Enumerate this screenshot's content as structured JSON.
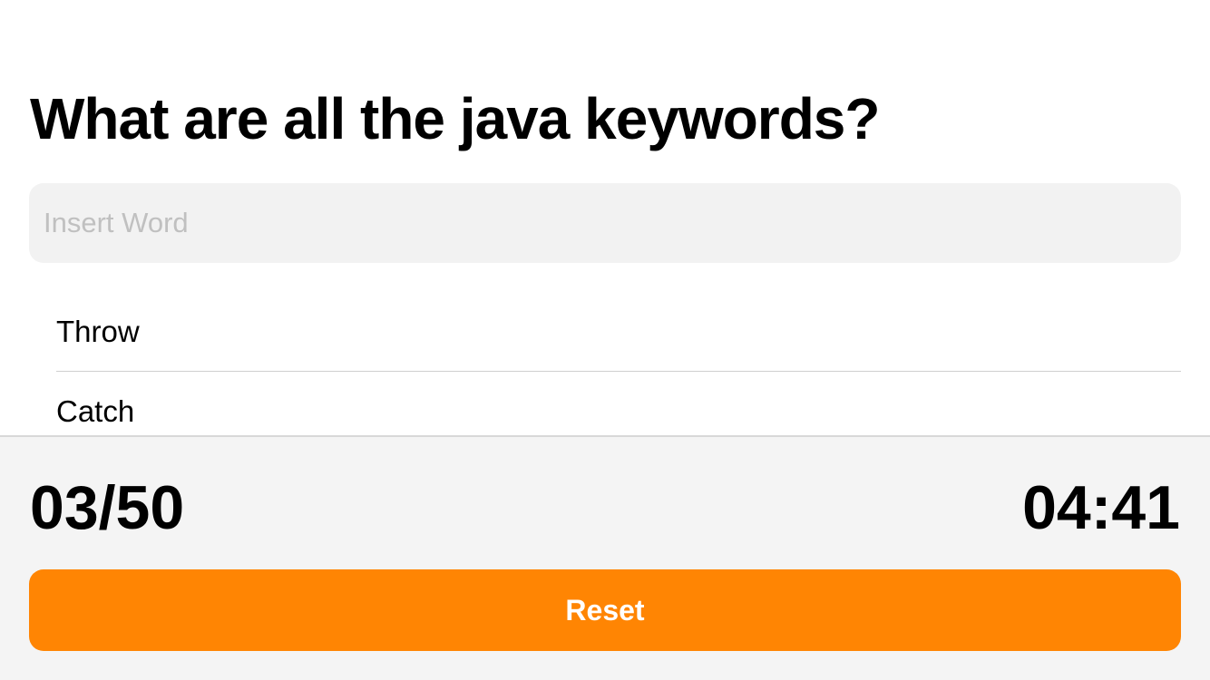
{
  "question": {
    "title": "What are all the java keywords?"
  },
  "input": {
    "placeholder": "Insert Word",
    "value": ""
  },
  "answers": [
    {
      "label": "Throw"
    },
    {
      "label": "Catch"
    }
  ],
  "footer": {
    "score": "03/50",
    "timer": "04:41",
    "reset_label": "Reset"
  },
  "colors": {
    "accent": "#ff8503",
    "input_background": "#f2f2f2",
    "footer_background": "#f4f4f4"
  }
}
